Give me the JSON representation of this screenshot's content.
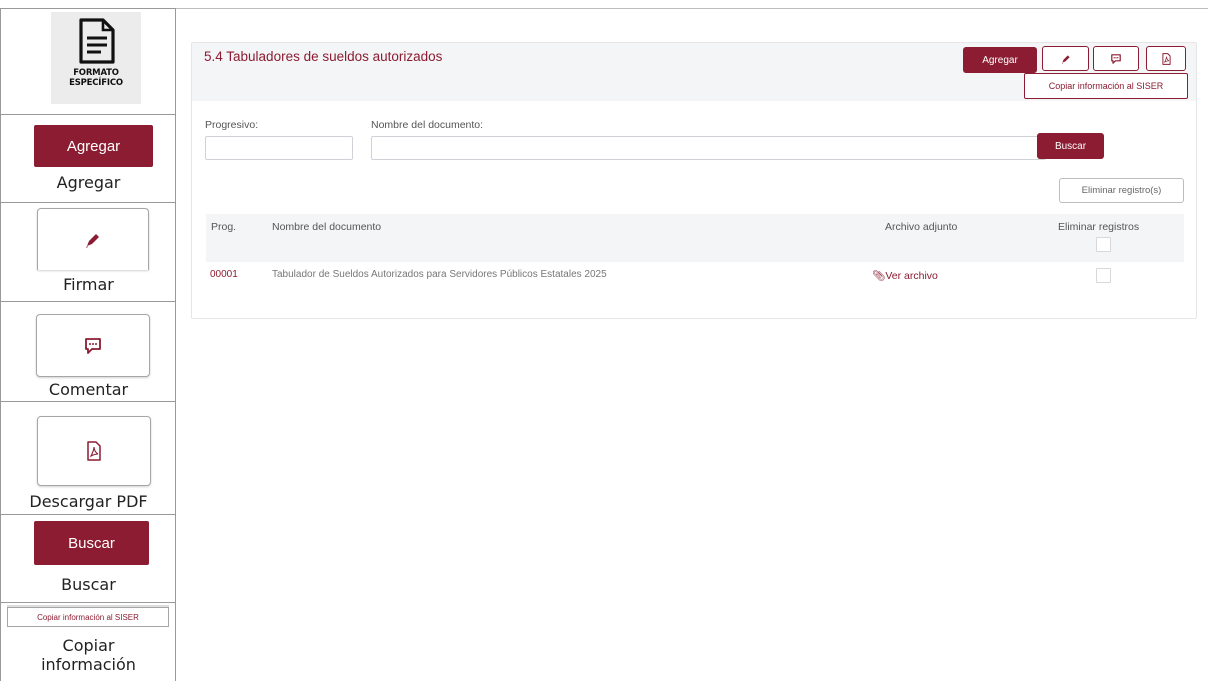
{
  "legend": {
    "logo_line1": "FORMATO",
    "logo_line2": "ESPECÍFICO",
    "agregar_button": "Agregar",
    "agregar_caption": "Agregar",
    "firmar_caption": "Firmar",
    "comentar_caption": "Comentar",
    "pdf_caption": "Descargar PDF",
    "buscar_button": "Buscar",
    "buscar_caption": "Buscar",
    "copiar_button": "Copiar información al SISER",
    "copiar_caption_line1": "Copiar",
    "copiar_caption_line2": "información"
  },
  "panel": {
    "title": "5.4 Tabuladores de sueldos autorizados",
    "agregar_label": "Agregar",
    "copiar_label": "Copiar información al SISER"
  },
  "filters": {
    "progresivo_label": "Progresivo:",
    "progresivo_value": "",
    "nombre_label": "Nombre del documento:",
    "nombre_value": "",
    "buscar_label": "Buscar",
    "eliminar_label": "Eliminar registro(s)"
  },
  "table": {
    "headers": [
      "Prog.",
      "Nombre del documento",
      "Archivo adjunto",
      "Eliminar registros"
    ],
    "rows": [
      {
        "prog": "00001",
        "nombre": "Tabulador de Sueldos Autorizados para Servidores Públicos Estatales 2025",
        "archivo": "Ver archivo"
      }
    ]
  },
  "colors": {
    "brand": "#8b1c31",
    "header_bg": "#f4f5f7",
    "border": "#cfd3d7"
  },
  "icons": [
    "document-icon",
    "pen-icon",
    "comment-icon",
    "pdf-icon",
    "paperclip-icon"
  ]
}
